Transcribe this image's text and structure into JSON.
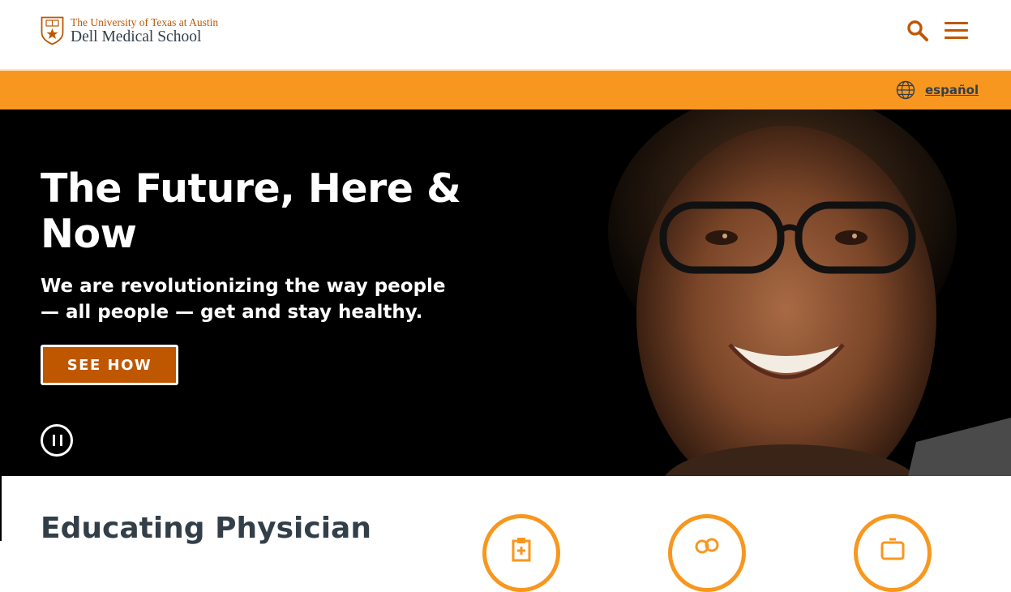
{
  "header": {
    "logo": {
      "university": "The University of Texas at Austin",
      "school": "Dell Medical School"
    },
    "search_icon": "search-icon",
    "menu_icon": "hamburger-menu-icon"
  },
  "language_bar": {
    "globe_icon": "globe-icon",
    "link_label": "español"
  },
  "hero": {
    "title": "The Future, Here & Now",
    "subtitle": "We are revolutionizing the way people — all people — get and stay healthy.",
    "cta_label": "SEE HOW",
    "pause_icon": "pause-icon"
  },
  "section": {
    "title": "Educating Physician",
    "icons": [
      "clipboard-icon",
      "chat-bubbles-icon",
      "screen-icon"
    ]
  },
  "colors": {
    "burnt_orange": "#bf5700",
    "light_orange": "#f8971f",
    "charcoal": "#333f48",
    "hero_bg": "#000000"
  }
}
